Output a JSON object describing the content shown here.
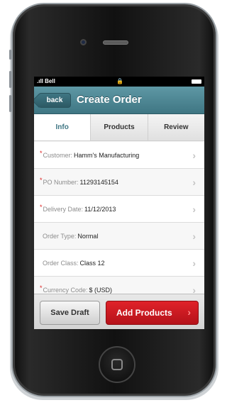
{
  "status": {
    "carrier": "Bell",
    "lock_glyph": "🔒"
  },
  "nav": {
    "back_label": "back",
    "title": "Create Order"
  },
  "tabs": [
    {
      "label": "Info",
      "active": true
    },
    {
      "label": "Products",
      "active": false
    },
    {
      "label": "Review",
      "active": false
    }
  ],
  "fields": [
    {
      "required": true,
      "label": "Customer:",
      "value": "Hamm's Manufacturing"
    },
    {
      "required": true,
      "label": "PO Number:",
      "value": "11293145154"
    },
    {
      "required": true,
      "label": "Delivery Date:",
      "value": "11/12/2013"
    },
    {
      "required": false,
      "label": "Order Type:",
      "value": "Normal"
    },
    {
      "required": false,
      "label": "Order Class:",
      "value": "Class 12"
    },
    {
      "required": true,
      "label": "Currency Code:",
      "value": "$ (USD)"
    }
  ],
  "footer": {
    "save_draft_label": "Save Draft",
    "add_products_label": "Add Products"
  },
  "colors": {
    "nav": "#4f8794",
    "accent": "#d81a22",
    "required": "#dd2222"
  }
}
